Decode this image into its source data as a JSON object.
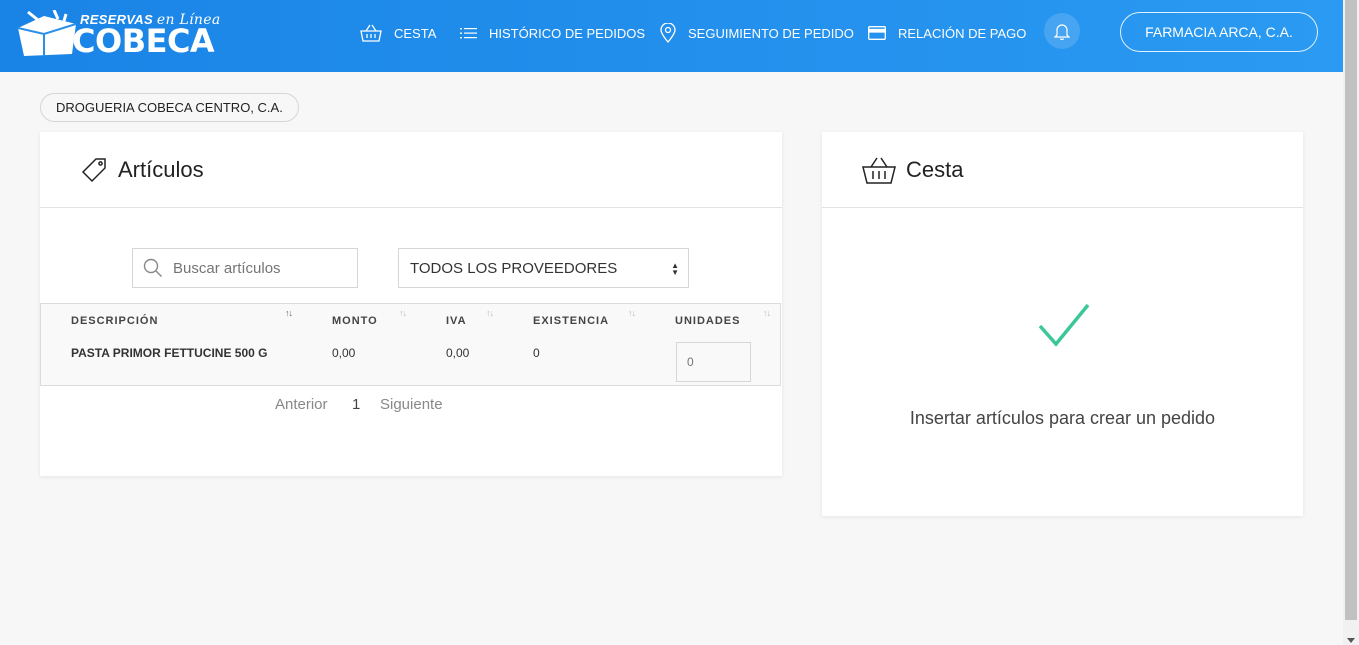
{
  "header": {
    "logo": {
      "small": "RESERVAS",
      "script": "en Línea",
      "big": "COBECA"
    },
    "nav": [
      {
        "label": "CESTA",
        "icon": "basket-icon"
      },
      {
        "label": "HISTÓRICO DE PEDIDOS",
        "icon": "list-icon"
      },
      {
        "label": "SEGUIMIENTO DE PEDIDO",
        "icon": "location-pin-icon"
      },
      {
        "label": "RELACIÓN DE PAGO",
        "icon": "credit-card-icon"
      }
    ],
    "notifications_icon": "bell-icon",
    "account_label": "FARMACIA ARCA, C.A."
  },
  "supplier_pill": "DROGUERIA COBECA CENTRO, C.A.",
  "articulos": {
    "title": "Artículos",
    "search_placeholder": "Buscar artículos",
    "provider_select": "TODOS LOS PROVEEDORES",
    "columns": [
      "DESCRIPCIÓN",
      "MONTO",
      "IVA",
      "EXISTENCIA",
      "UNIDADES"
    ],
    "rows": [
      {
        "descripcion": "PASTA PRIMOR FETTUCINE 500 G",
        "monto": "0,00",
        "iva": "0,00",
        "existencia": "0",
        "unidades_placeholder": "0"
      }
    ],
    "pagination": {
      "prev": "Anterior",
      "page": "1",
      "next": "Siguiente"
    }
  },
  "cesta": {
    "title": "Cesta",
    "empty_message": "Insertar artículos para crear un pedido"
  },
  "colors": {
    "header_start": "#1a84e6",
    "header_end": "#2a9af2",
    "check": "#3cc79a"
  }
}
